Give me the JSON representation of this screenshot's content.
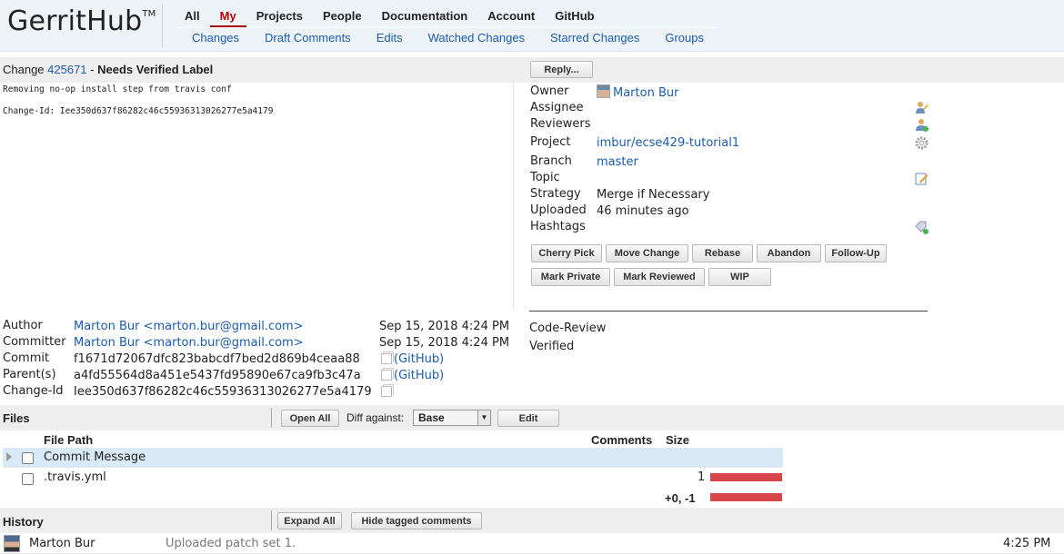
{
  "logo": {
    "text": "GerritHub",
    "tm": "TM"
  },
  "top_menu": {
    "items": [
      {
        "label": "All",
        "active": false
      },
      {
        "label": "My",
        "active": true
      },
      {
        "label": "Projects",
        "active": false
      },
      {
        "label": "People",
        "active": false
      },
      {
        "label": "Documentation",
        "active": false
      },
      {
        "label": "Account",
        "active": false
      },
      {
        "label": "GitHub",
        "active": false
      }
    ],
    "sub_items": [
      "Changes",
      "Draft Comments",
      "Edits",
      "Watched Changes",
      "Starred Changes",
      "Groups"
    ]
  },
  "change": {
    "prefix": "Change ",
    "number": "425671",
    "separator": " - ",
    "status": "Needs Verified Label",
    "reply_label": "Reply...",
    "commit_message_line1": "Removing no-op install step from travis conf",
    "commit_message_line2": "Change-Id: Iee350d637f86282c46c55936313026277e5a4179"
  },
  "info": {
    "owner_label": "Owner",
    "owner_value": "Marton Bur",
    "assignee_label": "Assignee",
    "reviewers_label": "Reviewers",
    "project_label": "Project",
    "project_value": "imbur/ecse429-tutorial1",
    "branch_label": "Branch",
    "branch_value": "master",
    "topic_label": "Topic",
    "strategy_label": "Strategy",
    "strategy_value": "Merge if Necessary",
    "uploaded_label": "Uploaded",
    "uploaded_value": "46 minutes ago",
    "hashtags_label": "Hashtags"
  },
  "actions": {
    "row1": [
      "Cherry Pick",
      "Move Change",
      "Rebase",
      "Abandon",
      "Follow-Up"
    ],
    "row2": [
      "Mark Private",
      "Mark Reviewed",
      "WIP"
    ]
  },
  "commit_info": {
    "author_label": "Author",
    "author_value": "Marton Bur <marton.bur@gmail.com>",
    "author_date": "Sep 15, 2018 4:24 PM",
    "committer_label": "Committer",
    "committer_value": "Marton Bur <marton.bur@gmail.com>",
    "committer_date": "Sep 15, 2018 4:24 PM",
    "commit_label": "Commit",
    "commit_value": "f1671d72067dfc823babcdf7bed2d869b4ceaa88",
    "commit_link": "(GitHub)",
    "parent_label": "Parent(s)",
    "parent_value": "a4fd55564d8a451e5437fd95890e67ca9fb3c47a",
    "parent_link": "(GitHub)",
    "changeid_label": "Change-Id",
    "changeid_value": "Iee350d637f86282c46c55936313026277e5a4179"
  },
  "labels": {
    "code_review": "Code-Review",
    "verified": "Verified"
  },
  "files": {
    "title": "Files",
    "open_all": "Open All",
    "diff_against_label": "Diff against:",
    "diff_against_value": "Base",
    "edit": "Edit",
    "col_path": "File Path",
    "col_comments": "Comments",
    "col_size": "Size",
    "rows": [
      {
        "name": "Commit Message",
        "comments": "",
        "size_fraction": 0
      },
      {
        "name": ".travis.yml",
        "comments": "1",
        "size_fraction": 1
      }
    ],
    "total": "+0, -1",
    "total_fraction": 1
  },
  "history": {
    "title": "History",
    "expand_all": "Expand All",
    "hide_tagged": "Hide tagged comments",
    "entry_author": "Marton Bur",
    "entry_text": "Uploaded patch set 1.",
    "entry_time": "4:25 PM"
  },
  "colors": {
    "link": "#1a5cae",
    "active_menu": "#aa0000",
    "size_bar": "#d8454a",
    "row_highlight": "#d9e9f7"
  }
}
